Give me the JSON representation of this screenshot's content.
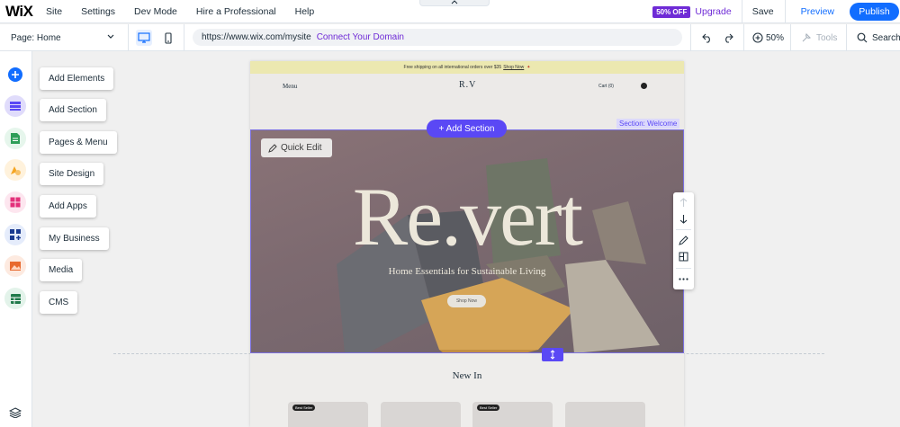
{
  "topbar": {
    "logo": "WiX",
    "nav": [
      "Site",
      "Settings",
      "Dev Mode",
      "Hire a Professional",
      "Help"
    ],
    "badge": "50% OFF",
    "upgrade": "Upgrade",
    "save": "Save",
    "preview": "Preview",
    "publish": "Publish"
  },
  "bar2": {
    "page": "Page: Home",
    "url": "https://www.wix.com/mysite",
    "connect": "Connect Your Domain",
    "zoom": "50%",
    "tools": "Tools",
    "search": "Search"
  },
  "menu": {
    "items": [
      "Add Elements",
      "Add Section",
      "Pages & Menu",
      "Site Design",
      "Add Apps",
      "My Business",
      "Media",
      "CMS"
    ]
  },
  "colors": {
    "accent": "#116dff",
    "upgrade": "#6f2bd6",
    "section": "#5a48f5"
  },
  "sidebar": {
    "icons": [
      "plus-icon",
      "section-icon",
      "page-icon",
      "paint-icon",
      "apps-icon",
      "business-icon",
      "media-icon",
      "cms-icon"
    ]
  },
  "canvas": {
    "promo": "Free shipping on all international orders over $35",
    "promo_link": "Shop Now",
    "menu": "Menu",
    "logo": "R.V",
    "cart": "Cart (0)",
    "quick_edit": "Quick Edit",
    "add_section": "+ Add Section",
    "section_label": "Section: Welcome",
    "hero_title": "Re.vert",
    "hero_sub": "Home Essentials for Sustainable Living",
    "shop_now": "Shop Now",
    "new_in": "New In",
    "best_seller": "Best Seller"
  }
}
